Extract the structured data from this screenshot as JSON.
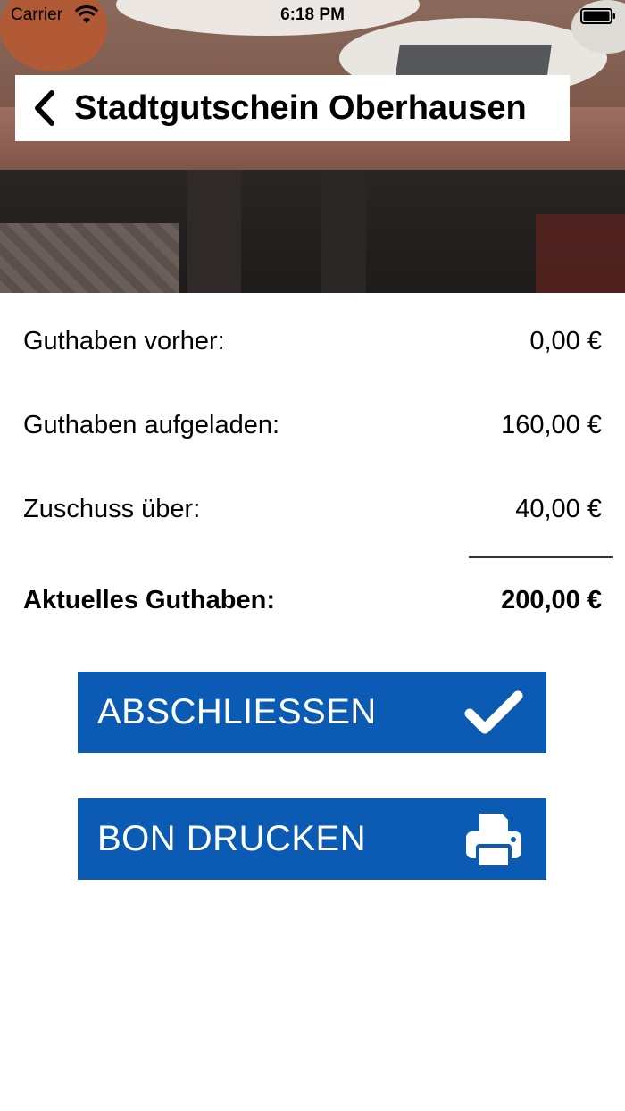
{
  "status_bar": {
    "carrier": "Carrier",
    "time": "6:18 PM"
  },
  "header": {
    "title": "Stadtgutschein Oberhausen",
    "back_icon": "chevron-left-icon"
  },
  "summary": {
    "rows": [
      {
        "label": "Guthaben vorher:",
        "value": "0,00 €"
      },
      {
        "label": "Guthaben aufgeladen:",
        "value": "160,00 €"
      },
      {
        "label": "Zuschuss über:",
        "value": "40,00 €"
      }
    ],
    "total": {
      "label": "Aktuelles Guthaben:",
      "value": "200,00 €"
    }
  },
  "actions": {
    "finish": {
      "label": "ABSCHLIESSEN",
      "icon": "checkmark-icon"
    },
    "print": {
      "label": "BON DRUCKEN",
      "icon": "printer-icon"
    }
  },
  "colors": {
    "button_bg": "#0b5bb5",
    "button_text": "#ffffff"
  }
}
